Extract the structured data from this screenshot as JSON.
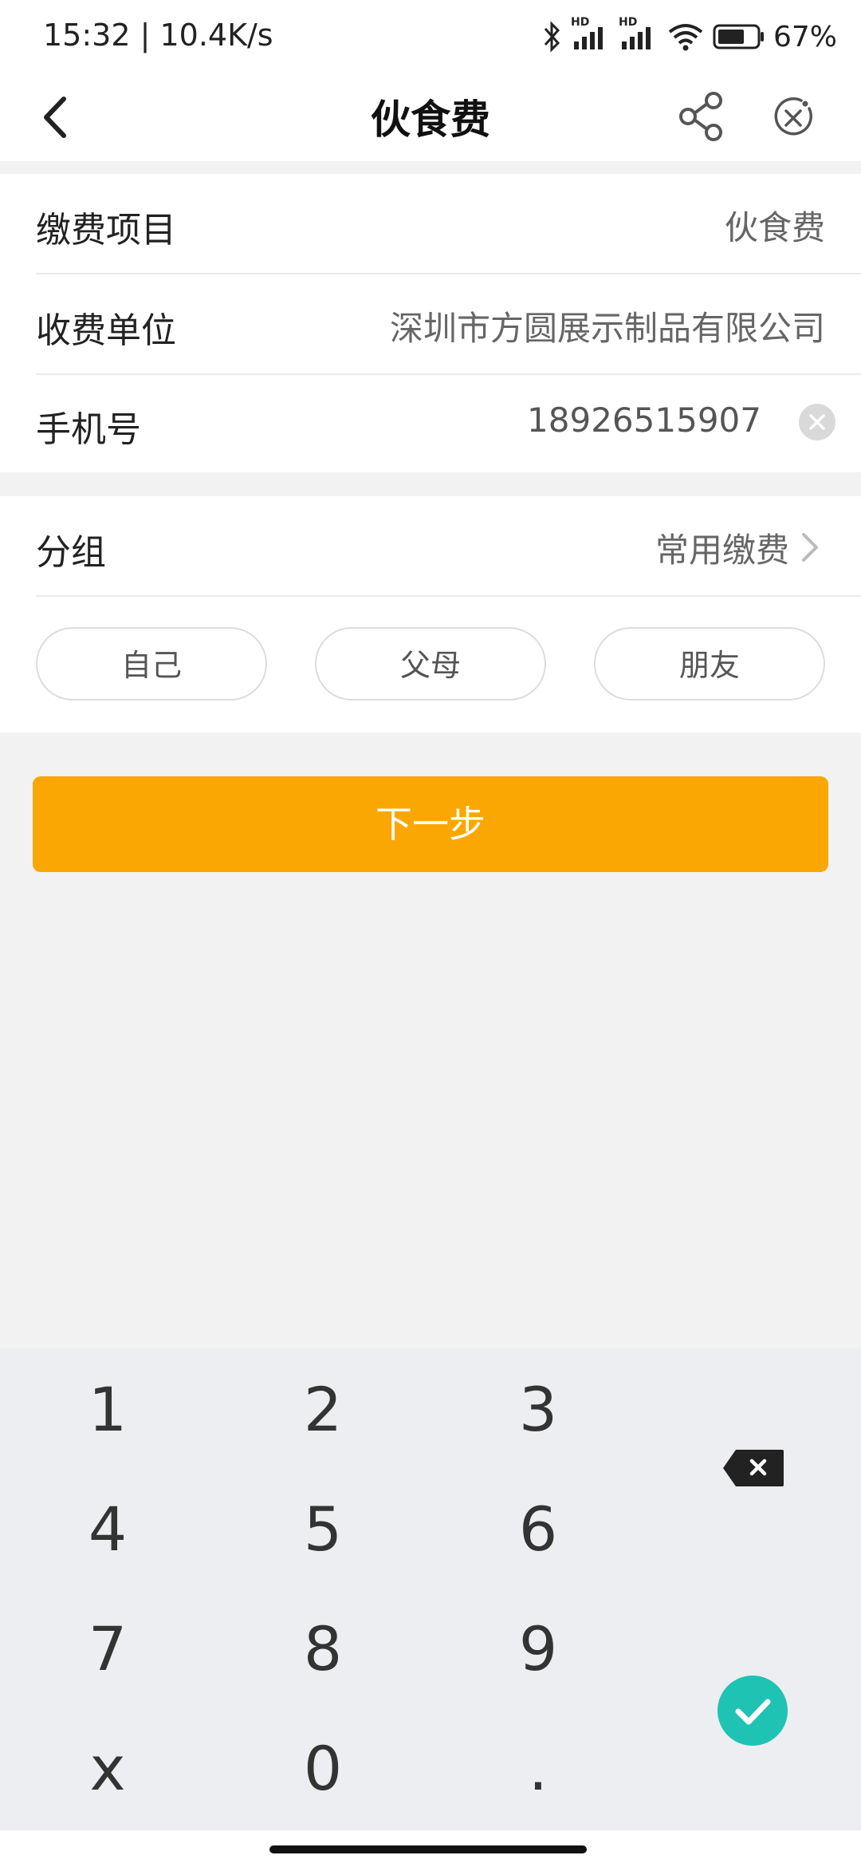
{
  "status": {
    "time": "15:32 | 10.4K/s",
    "battery": "67%",
    "signal_label_1": "HD",
    "signal_label_2": "HD"
  },
  "nav": {
    "title": "伙食费"
  },
  "form": {
    "item_label": "缴费项目",
    "item_value": "伙食费",
    "payee_label": "收费单位",
    "payee_value": "深圳市方圆展示制品有限公司",
    "phone_label": "手机号",
    "phone_value": "18926515907"
  },
  "group": {
    "label": "分组",
    "value": "常用缴费",
    "chips": [
      "自己",
      "父母",
      "朋友"
    ]
  },
  "next_button": "下一步",
  "keyboard": {
    "keys": [
      "1",
      "2",
      "3",
      "4",
      "5",
      "6",
      "7",
      "8",
      "9",
      "x",
      "0",
      "."
    ]
  },
  "colors": {
    "accent": "#fba703",
    "confirm": "#1fc3b3"
  }
}
